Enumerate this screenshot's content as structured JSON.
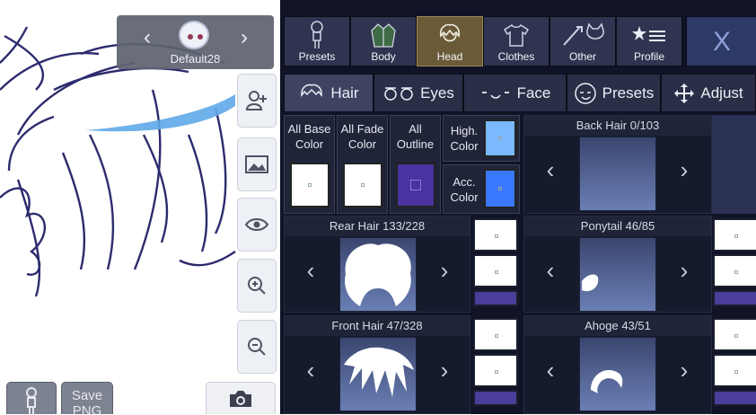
{
  "character": {
    "name": "Default28"
  },
  "categories": [
    {
      "label": "Presets",
      "icon": "person-icon"
    },
    {
      "label": "Body",
      "icon": "jacket-icon"
    },
    {
      "label": "Head",
      "icon": "hair-icon"
    },
    {
      "label": "Clothes",
      "icon": "shirt-icon"
    },
    {
      "label": "Other",
      "icon": "sword-cat-icon"
    },
    {
      "label": "Profile",
      "icon": "star-list-icon"
    }
  ],
  "close_label": "X",
  "tabs": [
    {
      "label": "Hair",
      "icon": "hair-icon"
    },
    {
      "label": "Eyes",
      "icon": "eyes-icon"
    },
    {
      "label": "Face",
      "icon": "face-icon"
    },
    {
      "label": "Presets",
      "icon": "face-presets-icon"
    },
    {
      "label": "Adjust",
      "icon": "move-icon"
    }
  ],
  "colors": {
    "all_base": "All Base Color",
    "all_fade": "All Fade Color",
    "all_outline": "All Outline",
    "high": "High. Color",
    "acc": "Acc. Color",
    "outline_hex": "#4a32a0",
    "high_hex": "#7ab8ff",
    "acc_hex": "#3a78ff",
    "bar_hex": "#4b3d9a"
  },
  "parts": {
    "back_hair": "Back Hair 0/103",
    "rear_hair": "Rear Hair 133/228",
    "ponytail": "Ponytail 46/85",
    "front_hair": "Front Hair 47/328",
    "ahoge": "Ahoge 43/51"
  },
  "bottom": {
    "save_label": "Save PNG"
  }
}
